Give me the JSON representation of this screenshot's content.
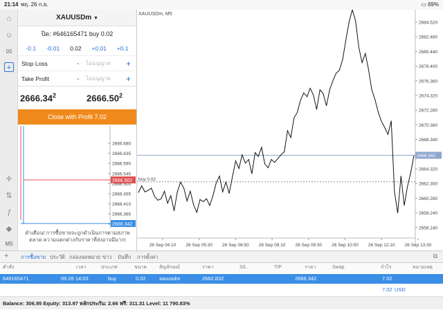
{
  "status": {
    "time": "21:14",
    "date": "พฤ. 26 ก.ย.",
    "battery": "69%"
  },
  "order_panel": {
    "symbol": "XAUUSDm",
    "ticket": "ปิด: #646165471 buy 0.02",
    "vol_buttons": [
      "-0.1",
      "-0.01",
      "0.02",
      "+0.01",
      "+0.1"
    ],
    "stop_loss_label": "Stop Loss",
    "take_profit_label": "Take Profit",
    "placeholder": "ไม่อนุญาต",
    "minus": "-",
    "plus": "+",
    "bid_main": "2666.34",
    "bid_sup": "2",
    "ask_main": "2666.50",
    "ask_sup": "2",
    "close_button": "Close with Profit 7.02",
    "warning": "คำเตือน! การซื้อขายจะถูกดำเนินการตามสภาพตลาด ความแตกต่างกับราคาที่ส่งอาจมีมาก!"
  },
  "left_toolbar_icons": [
    "home-icon",
    "person-icon",
    "chat-icon",
    "add-order-icon",
    "crosshair-icon",
    "indicator-icon",
    "function-icon",
    "objects-icon",
    "timeframe-M5"
  ],
  "left_toolbar_tf": "M5",
  "mini_chart": {
    "ticks": [
      "2666.680",
      "2666.635",
      "2666.590",
      "2666.545",
      "2666.500",
      "2666.455",
      "2666.410",
      "2666.365",
      "2666.320"
    ],
    "red_label": "2666.502",
    "blue_label": "2666.342"
  },
  "main_chart": {
    "title": "XAUUSDm, M5",
    "order_line_label": "buy 0.02",
    "price_tag": "2666.342",
    "y_ticks": [
      "2684.520",
      "2682.480",
      "2680.440",
      "2678.400",
      "2676.360",
      "2674.320",
      "2672.280",
      "2670.380",
      "2668.340",
      "2666.300",
      "2664.320",
      "2662.300",
      "2660.280",
      "2658.240",
      "2656.240"
    ],
    "x_ticks": [
      "26 Sep 04:10",
      "26 Sep 05:30",
      "26 Sep 06:50",
      "26 Sep 08:10",
      "26 Sep 09:30",
      "26 Sep 10:50",
      "26 Sep 12:10",
      "26 Sep 13:30"
    ]
  },
  "chart_data": {
    "type": "line",
    "title": "XAUUSDm, M5",
    "ylim": [
      2655.4,
      2685.6
    ],
    "order_price": 2662.832,
    "current_price": 2666.342,
    "values": [
      2661.4,
      2662.3,
      2661.5,
      2661.7,
      2662.0,
      2660.9,
      2660.4,
      2660.6,
      2661.6,
      2660.0,
      2661.0,
      2659.0,
      2661.5,
      2662.8,
      2662.0,
      2660.3,
      2661.6,
      2659.8,
      2658.8,
      2660.5,
      2660.2,
      2660.6,
      2659.7,
      2661.0,
      2662.7,
      2663.6,
      2661.5,
      2662.8,
      2661.3,
      2663.5,
      2665.6,
      2664.6,
      2666.4,
      2665.3,
      2665.8,
      2663.9,
      2666.7,
      2666.2,
      2667.4,
      2665.2,
      2664.7,
      2665.8,
      2665.4,
      2665.9,
      2666.4,
      2666.8,
      2669.6,
      2668.7,
      2671.3,
      2672.0,
      2673.6,
      2674.6,
      2674.1,
      2675.2,
      2674.3,
      2672.4,
      2675.0,
      2674.5,
      2672.9,
      2675.0,
      2676.2,
      2677.2,
      2677.6,
      2679.0,
      2681.6,
      2684.0,
      2685.6,
      2684.1,
      2680.6,
      2678.6,
      2679.8,
      2677.7,
      2675.0,
      2673.7,
      2672.0,
      2670.8,
      2670.0,
      2669.1,
      2670.9,
      2661.5,
      2658.7,
      2663.6,
      2659.7,
      2662.2,
      2664.0,
      2666.3
    ]
  },
  "tabs": [
    "การซื้อขาย",
    "ประวัติ",
    "กล่องจดหมาย",
    "ข่าว",
    "บันทึก",
    "การตั้งค่า"
  ],
  "table": {
    "headers": [
      "คำสั่ง",
      "เวลา",
      "ประเภท",
      "ขนาด",
      "สัญลักษณ์",
      "ราคา",
      "S/L",
      "T/P",
      "ราคา",
      "Swap",
      "กำไร",
      "หมายเหตุ"
    ],
    "row": {
      "order": "646165471",
      "time": "09.26 14:03",
      "type": "buy",
      "size": "0.02",
      "symbol": "xauusdm",
      "price_open": "2662.832",
      "price_current": "2666.342",
      "profit": "7.02"
    },
    "summary_profit": "7.02",
    "summary_currency": "USD",
    "balance_line": "Balance: 306.95 Equity: 313.97 หลักประกัน: 2.66 ฟรี: 311.31 Level: 11 790.83%"
  }
}
